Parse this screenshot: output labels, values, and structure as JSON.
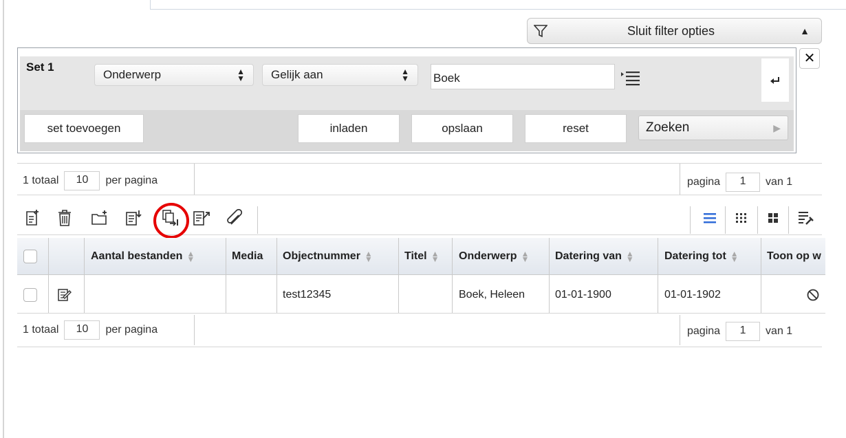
{
  "filter": {
    "toggle_label": "Sluit filter opties",
    "set_label": "Set 1",
    "field_select": "Onderwerp",
    "operator_select": "Gelijk aan",
    "value_input": "Boek",
    "buttons": {
      "add_set": "set toevoegen",
      "load": "inladen",
      "save": "opslaan",
      "reset": "reset",
      "search": "Zoeken"
    }
  },
  "pagination_top": {
    "total": "1 totaal",
    "per_page_value": "10",
    "per_page_label": "per pagina",
    "page_label": "pagina",
    "page_value": "1",
    "of_label": "van 1"
  },
  "pagination_bottom": {
    "total": "1 totaal",
    "per_page_value": "10",
    "per_page_label": "per pagina",
    "page_label": "pagina",
    "page_value": "1",
    "of_label": "van 1"
  },
  "table": {
    "columns": [
      "Aantal bestanden",
      "Media",
      "Objectnummer",
      "Titel",
      "Onderwerp",
      "Datering van",
      "Datering tot",
      "Toon op w"
    ],
    "rows": [
      {
        "aantal_bestanden": "",
        "media": "",
        "objectnummer": "test12345",
        "titel": "",
        "onderwerp": "Boek, Heleen",
        "datering_van": "01-01-1900",
        "datering_tot": "01-01-1902"
      }
    ]
  },
  "icons": {
    "toolbar": [
      "new-record-icon",
      "delete-icon",
      "new-folder-icon",
      "import-icon",
      "copy-records-icon",
      "export-edit-icon",
      "link-icon"
    ],
    "view": [
      "list-view-icon",
      "grid-small-view-icon",
      "grid-large-view-icon",
      "column-settings-icon"
    ],
    "row": [
      "edit-record-icon",
      "not-visible-icon"
    ]
  },
  "colors": {
    "accent_blue": "#2f6bd8",
    "highlight_red": "#e60000",
    "header_bg": "#e8ecf2",
    "filter_bg": "#e6e6e6"
  }
}
